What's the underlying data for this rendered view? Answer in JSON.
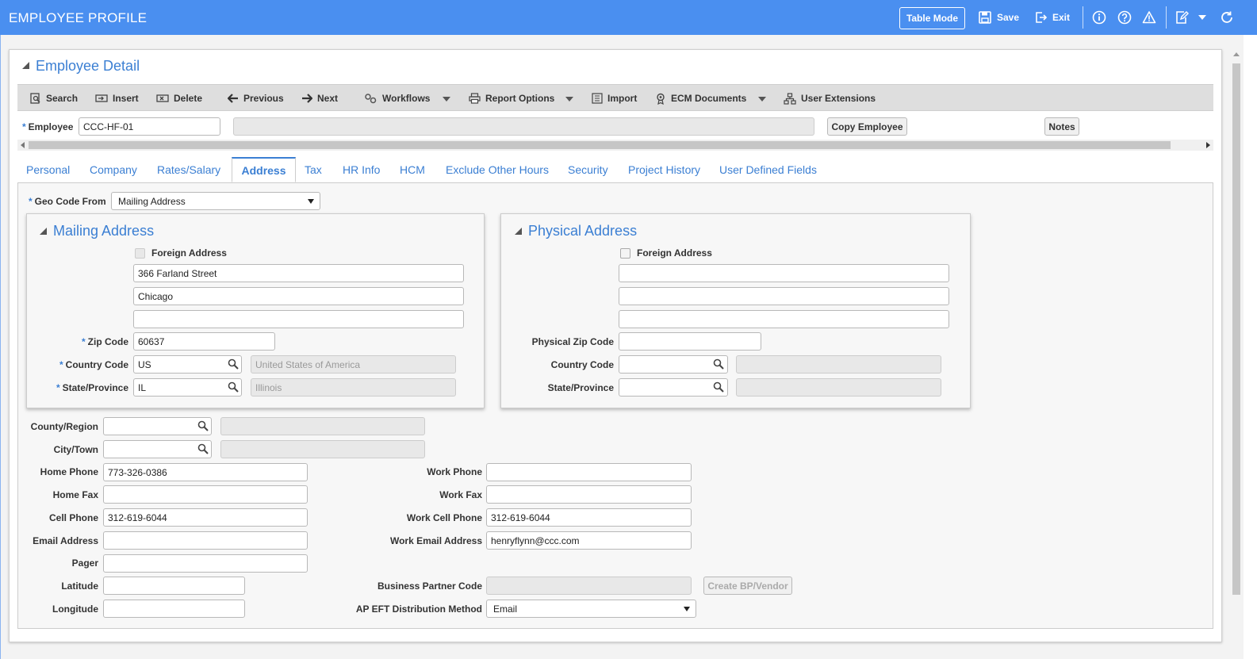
{
  "app": {
    "title": "EMPLOYEE PROFILE"
  },
  "topbar": {
    "table_mode": "Table Mode",
    "save": "Save",
    "exit": "Exit"
  },
  "section": {
    "title": "Employee Detail"
  },
  "toolbar": {
    "search": "Search",
    "insert": "Insert",
    "delete": "Delete",
    "previous": "Previous",
    "next": "Next",
    "workflows": "Workflows",
    "report_options": "Report Options",
    "import": "Import",
    "ecm_documents": "ECM Documents",
    "user_extensions": "User Extensions"
  },
  "header": {
    "employee_label": "Employee",
    "employee_value": "CCC-HF-01",
    "copy_employee": "Copy Employee",
    "notes": "Notes"
  },
  "tabs": [
    "Personal",
    "Company",
    "Rates/Salary",
    "Address",
    "Tax",
    "HR Info",
    "HCM",
    "Exclude Other Hours",
    "Security",
    "Project History",
    "User Defined Fields"
  ],
  "form": {
    "geo_code_label": "Geo Code From",
    "geo_code_value": "Mailing Address",
    "mailing": {
      "title": "Mailing Address",
      "foreign_label": "Foreign Address",
      "line1": "366 Farland Street",
      "line2": "Chicago",
      "line3": "",
      "zip_label": "Zip Code",
      "zip": "60637",
      "country_label": "Country Code",
      "country": "US",
      "country_desc": "United States of America",
      "state_label": "State/Province",
      "state": "IL",
      "state_desc": "Illinois"
    },
    "physical": {
      "title": "Physical Address",
      "foreign_label": "Foreign Address",
      "zip_label": "Physical Zip Code",
      "country_label": "Country Code",
      "state_label": "State/Province"
    },
    "county_label": "County/Region",
    "city_label": "City/Town",
    "home_phone_label": "Home Phone",
    "home_phone": "773-326-0386",
    "home_fax_label": "Home Fax",
    "cell_phone_label": "Cell Phone",
    "cell_phone": "312-619-6044",
    "email_label": "Email Address",
    "pager_label": "Pager",
    "latitude_label": "Latitude",
    "longitude_label": "Longitude",
    "work_phone_label": "Work Phone",
    "work_fax_label": "Work Fax",
    "work_cell_label": "Work Cell Phone",
    "work_cell": "312-619-6044",
    "work_email_label": "Work Email Address",
    "work_email": "henryflynn@ccc.com",
    "bp_code_label": "Business Partner Code",
    "create_bp": "Create BP/Vendor",
    "ap_eft_label": "AP EFT Distribution Method",
    "ap_eft_value": "Email"
  }
}
